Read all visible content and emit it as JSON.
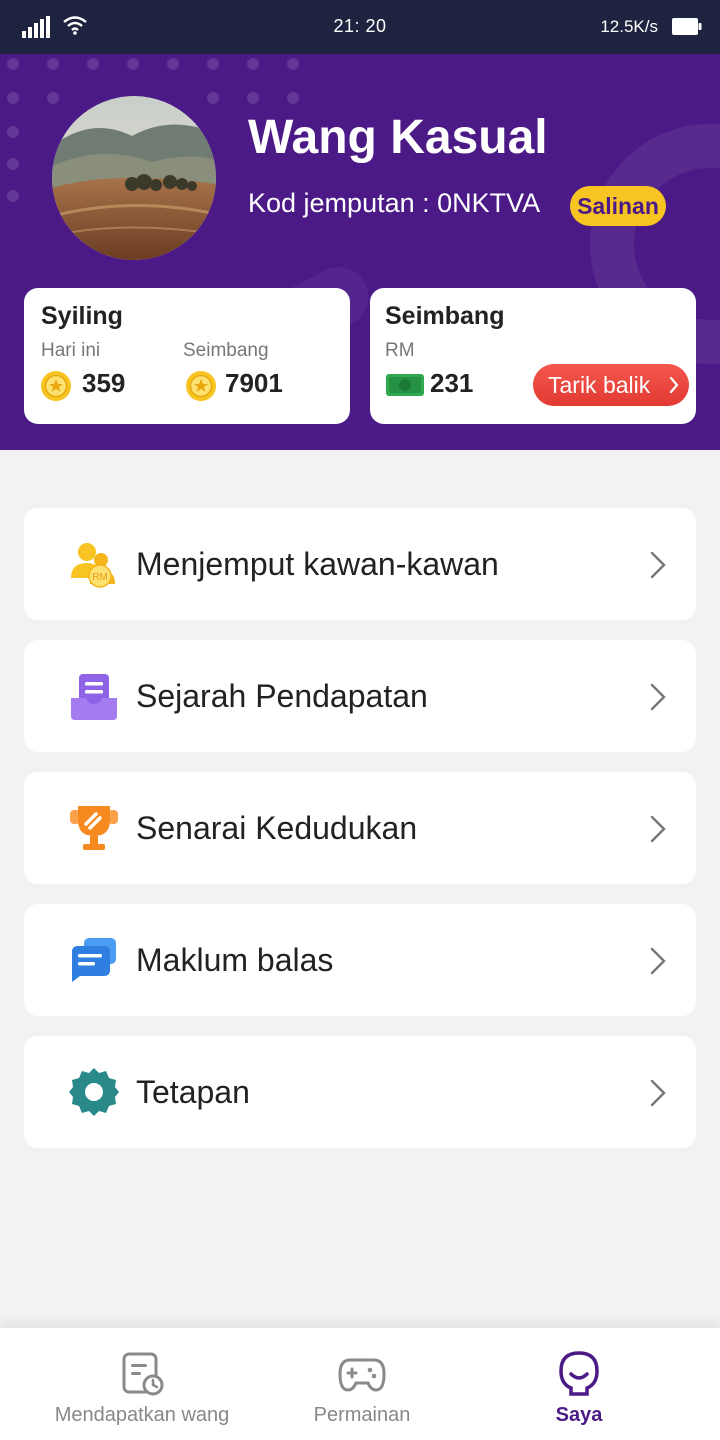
{
  "status_bar": {
    "time": "21: 20",
    "net_speed": "12.5K/s"
  },
  "profile": {
    "name": "Wang Kasual",
    "invite_code_text": "Kod jemputan : 0NKTVA",
    "copy_label": "Salinan"
  },
  "coins_card": {
    "title": "Syiling",
    "today_label": "Hari ini",
    "today_value": "359",
    "balance_label": "Seimbang",
    "balance_value": "7901"
  },
  "balance_card": {
    "title": "Seimbang",
    "currency_label": "RM",
    "value": "231",
    "withdraw_label": "Tarik balik"
  },
  "menu": [
    {
      "label": "Menjemput kawan-kawan",
      "icon": "invite-friends-icon"
    },
    {
      "label": "Sejarah Pendapatan",
      "icon": "income-history-icon"
    },
    {
      "label": "Senarai Kedudukan",
      "icon": "trophy-icon"
    },
    {
      "label": "Maklum balas",
      "icon": "feedback-icon"
    },
    {
      "label": "Tetapan",
      "icon": "gear-icon"
    }
  ],
  "nav": [
    {
      "label": "Mendapatkan wang",
      "icon": "earn-icon",
      "active": false
    },
    {
      "label": "Permainan",
      "icon": "gamepad-icon",
      "active": false
    },
    {
      "label": "Saya",
      "icon": "profile-icon",
      "active": true
    }
  ],
  "colors": {
    "header_bg": "#4b1a86",
    "status_bar_bg": "#1e2340",
    "accent_yellow": "#f8c421",
    "withdraw_red": "#e23a33",
    "active_nav": "#4b1a86"
  }
}
